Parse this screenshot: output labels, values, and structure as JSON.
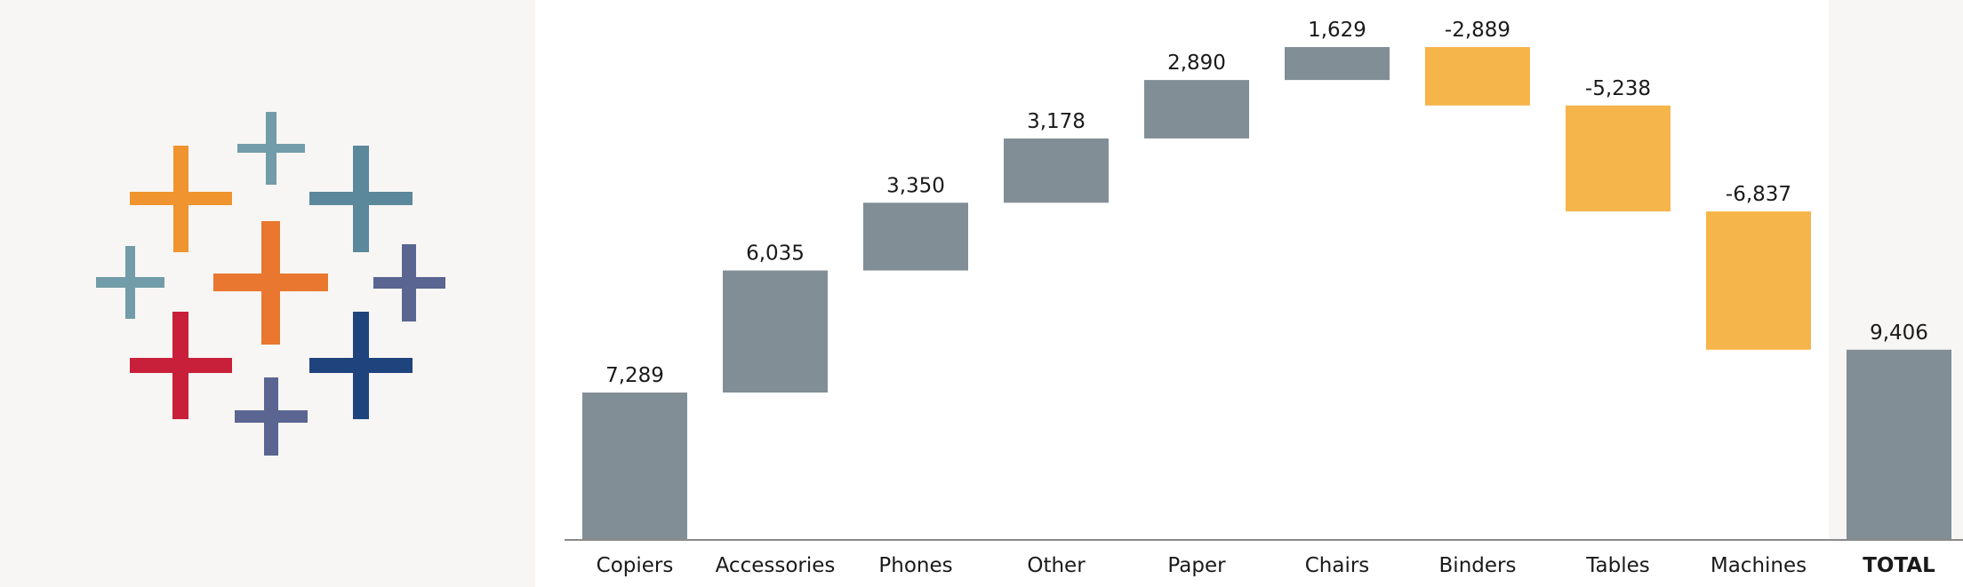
{
  "logo": {
    "name": "Tableau logo",
    "crosses": [
      {
        "id": "top-center",
        "color": "#729ca9"
      },
      {
        "id": "upper-left",
        "color": "#ef942e"
      },
      {
        "id": "upper-right",
        "color": "#5b889b"
      },
      {
        "id": "center",
        "color": "#e9772f"
      },
      {
        "id": "middle-left",
        "color": "#729ca8"
      },
      {
        "id": "middle-right",
        "color": "#5b6591"
      },
      {
        "id": "lower-left",
        "color": "#c8203a"
      },
      {
        "id": "lower-right",
        "color": "#1f447d"
      },
      {
        "id": "bottom-center",
        "color": "#5b6591"
      }
    ]
  },
  "colors": {
    "increase": "#818e96",
    "decrease": "#f6b54a",
    "total": "#818e96",
    "axis": "#8a8a8a",
    "panel_background": "#f7f6f4",
    "label_text": "#1a1a1a"
  },
  "chart_data": {
    "type": "bar",
    "subtype": "waterfall",
    "title": "",
    "xlabel": "",
    "ylabel": "",
    "categories": [
      "Copiers",
      "Accessories",
      "Phones",
      "Other",
      "Paper",
      "Chairs",
      "Binders",
      "Tables",
      "Machines",
      "TOTAL"
    ],
    "values": [
      7289,
      6035,
      3350,
      3178,
      2890,
      1629,
      -2889,
      -5238,
      -6837,
      9406
    ],
    "value_labels": [
      "7,289",
      "6,035",
      "3,350",
      "3,178",
      "2,890",
      "1,629",
      "-2,889",
      "-5,238",
      "-6,837",
      "9,406"
    ],
    "is_total": [
      false,
      false,
      false,
      false,
      false,
      false,
      false,
      false,
      false,
      true
    ],
    "ylim": [
      0,
      24371
    ],
    "grid": false,
    "legend": "none",
    "y_axis_shown": false
  }
}
